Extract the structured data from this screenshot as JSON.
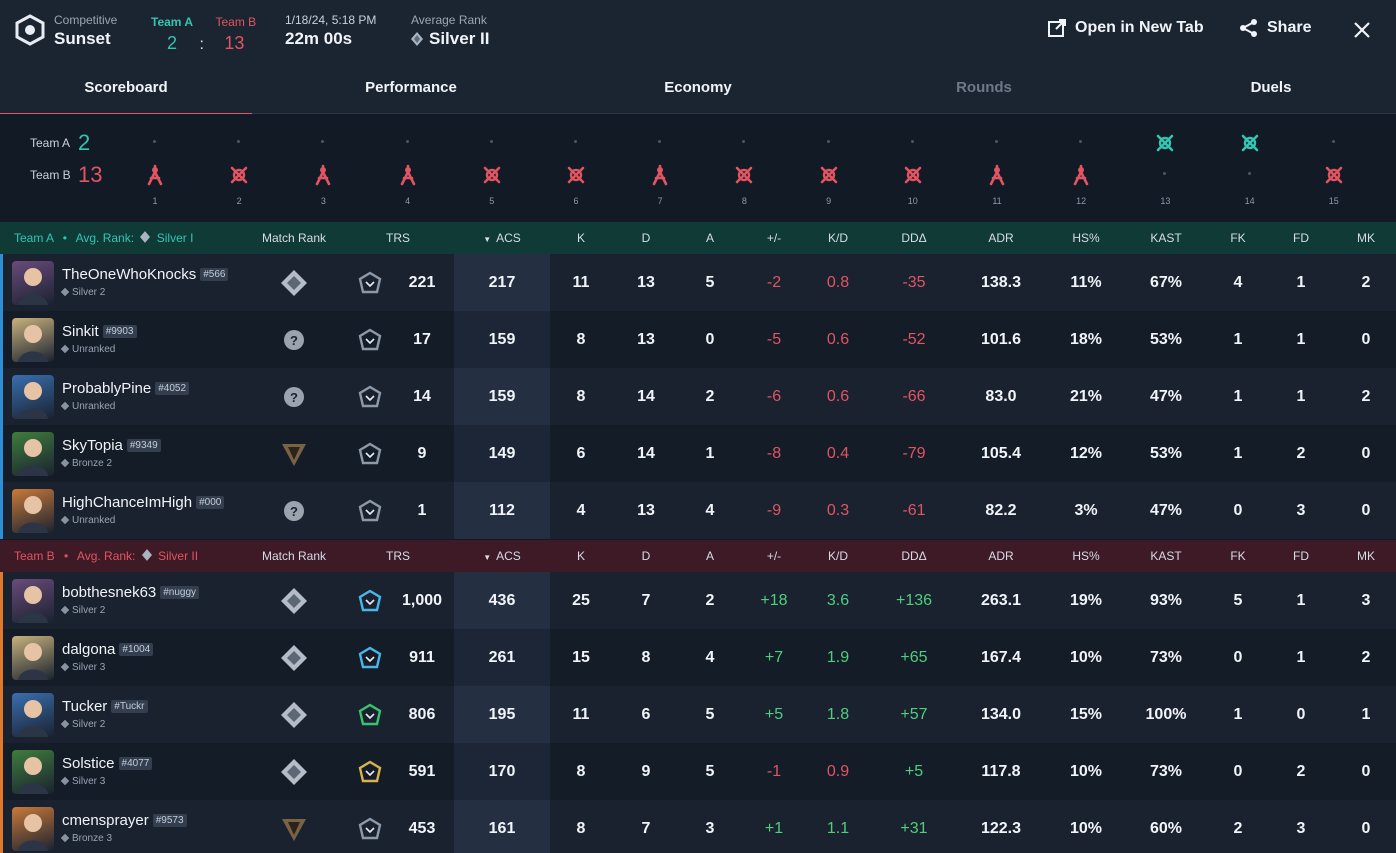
{
  "header": {
    "mode": "Competitive",
    "map": "Sunset",
    "team_a_label": "Team A",
    "team_b_label": "Team B",
    "score_a": "2",
    "score_sep": ":",
    "score_b": "13",
    "datetime": "1/18/24, 5:18 PM",
    "duration": "22m 00s",
    "avg_rank_label": "Average Rank",
    "avg_rank": "Silver II",
    "open_tab": "Open in New Tab",
    "share": "Share"
  },
  "tabs": [
    "Scoreboard",
    "Performance",
    "Economy",
    "Rounds",
    "Duels"
  ],
  "rounds": {
    "team_a_label": "Team A",
    "team_a_score": "2",
    "team_b_label": "Team B",
    "team_b_score": "13",
    "numbers": [
      "1",
      "2",
      "3",
      "4",
      "5",
      "6",
      "7",
      "8",
      "9",
      "10",
      "11",
      "12",
      "13",
      "14",
      "15"
    ],
    "winners": [
      "B",
      "B",
      "B",
      "B",
      "B",
      "B",
      "B",
      "B",
      "B",
      "B",
      "B",
      "B",
      "A",
      "A",
      "B"
    ],
    "icons": [
      "defuse",
      "elim",
      "defuse",
      "defuse",
      "elim",
      "elim",
      "defuse",
      "elim",
      "elim",
      "elim",
      "defuse",
      "defuse",
      "elim",
      "elim",
      "elim"
    ]
  },
  "columns": {
    "match_rank": "Match Rank",
    "trs": "TRS",
    "acs": "ACS",
    "k": "K",
    "d": "D",
    "a": "A",
    "pm": "+/-",
    "kd": "K/D",
    "dd": "DDΔ",
    "adr": "ADR",
    "hs": "HS%",
    "kast": "KAST",
    "fk": "FK",
    "fd": "FD",
    "mk": "MK"
  },
  "team_a": {
    "label": "Team A",
    "avg_rank_label": "Avg. Rank:",
    "avg_rank": "Silver I",
    "players": [
      {
        "name": "TheOneWhoKnocks",
        "tag": "#566",
        "rank": "Silver 2",
        "trs": "221",
        "acs": "217",
        "k": "11",
        "d": "13",
        "a": "5",
        "pm": "-2",
        "kd": "0.8",
        "dd": "-35",
        "adr": "138.3",
        "hs": "11%",
        "kast": "67%",
        "fk": "4",
        "fd": "1",
        "mk": "2"
      },
      {
        "name": "Sinkit",
        "tag": "#9903",
        "rank": "Unranked",
        "trs": "17",
        "acs": "159",
        "k": "8",
        "d": "13",
        "a": "0",
        "pm": "-5",
        "kd": "0.6",
        "dd": "-52",
        "adr": "101.6",
        "hs": "18%",
        "kast": "53%",
        "fk": "1",
        "fd": "1",
        "mk": "0"
      },
      {
        "name": "ProbablyPine",
        "tag": "#4052",
        "rank": "Unranked",
        "trs": "14",
        "acs": "159",
        "k": "8",
        "d": "14",
        "a": "2",
        "pm": "-6",
        "kd": "0.6",
        "dd": "-66",
        "adr": "83.0",
        "hs": "21%",
        "kast": "47%",
        "fk": "1",
        "fd": "1",
        "mk": "2"
      },
      {
        "name": "SkyTopia",
        "tag": "#9349",
        "rank": "Bronze 2",
        "trs": "9",
        "acs": "149",
        "k": "6",
        "d": "14",
        "a": "1",
        "pm": "-8",
        "kd": "0.4",
        "dd": "-79",
        "adr": "105.4",
        "hs": "12%",
        "kast": "53%",
        "fk": "1",
        "fd": "2",
        "mk": "0"
      },
      {
        "name": "HighChanceImHigh",
        "tag": "#000",
        "rank": "Unranked",
        "trs": "1",
        "acs": "112",
        "k": "4",
        "d": "13",
        "a": "4",
        "pm": "-9",
        "kd": "0.3",
        "dd": "-61",
        "adr": "82.2",
        "hs": "3%",
        "kast": "47%",
        "fk": "0",
        "fd": "3",
        "mk": "0"
      }
    ]
  },
  "team_b": {
    "label": "Team B",
    "avg_rank_label": "Avg. Rank:",
    "avg_rank": "Silver II",
    "players": [
      {
        "name": "bobthesnek63",
        "tag": "#nuggy",
        "rank": "Silver 2",
        "trs": "1,000",
        "acs": "436",
        "k": "25",
        "d": "7",
        "a": "2",
        "pm": "+18",
        "kd": "3.6",
        "dd": "+136",
        "adr": "263.1",
        "hs": "19%",
        "kast": "93%",
        "fk": "5",
        "fd": "1",
        "mk": "3"
      },
      {
        "name": "dalgona",
        "tag": "#1004",
        "rank": "Silver 3",
        "trs": "911",
        "acs": "261",
        "k": "15",
        "d": "8",
        "a": "4",
        "pm": "+7",
        "kd": "1.9",
        "dd": "+65",
        "adr": "167.4",
        "hs": "10%",
        "kast": "73%",
        "fk": "0",
        "fd": "1",
        "mk": "2"
      },
      {
        "name": "Tucker",
        "tag": "#Tuckr",
        "rank": "Silver 2",
        "trs": "806",
        "acs": "195",
        "k": "11",
        "d": "6",
        "a": "5",
        "pm": "+5",
        "kd": "1.8",
        "dd": "+57",
        "adr": "134.0",
        "hs": "15%",
        "kast": "100%",
        "fk": "1",
        "fd": "0",
        "mk": "1"
      },
      {
        "name": "Solstice",
        "tag": "#4077",
        "rank": "Silver 3",
        "trs": "591",
        "acs": "170",
        "k": "8",
        "d": "9",
        "a": "5",
        "pm": "-1",
        "kd": "0.9",
        "dd": "+5",
        "adr": "117.8",
        "hs": "10%",
        "kast": "73%",
        "fk": "0",
        "fd": "2",
        "mk": "0"
      },
      {
        "name": "cmensprayer",
        "tag": "#9573",
        "rank": "Bronze 3",
        "trs": "453",
        "acs": "161",
        "k": "8",
        "d": "7",
        "a": "3",
        "pm": "+1",
        "kd": "1.1",
        "dd": "+31",
        "adr": "122.3",
        "hs": "10%",
        "kast": "60%",
        "fk": "2",
        "fd": "3",
        "mk": "0"
      }
    ]
  },
  "colors": {
    "team_a": "#35c4b0",
    "team_b": "#e05561",
    "positive": "#4fcf7d",
    "negative": "#e05561"
  }
}
